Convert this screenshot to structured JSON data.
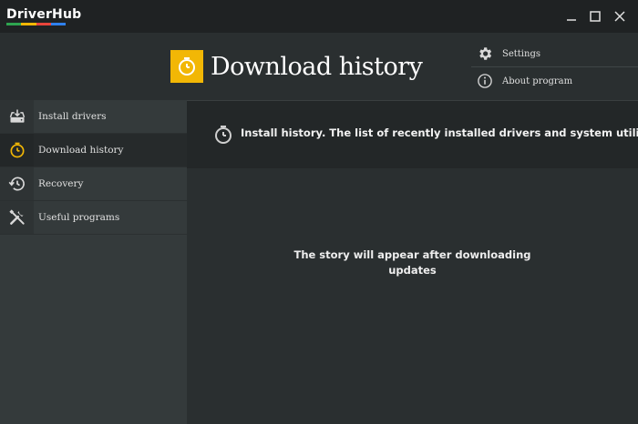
{
  "app": {
    "name": "DriverHub",
    "logo_colors": [
      "#2ea44f",
      "#f2b705",
      "#e8453c",
      "#2f80ed"
    ]
  },
  "window_controls": {
    "minimize_icon": "minimize-icon",
    "maximize_icon": "maximize-icon",
    "close_icon": "close-icon"
  },
  "page": {
    "title": "Download history",
    "title_icon": "stopwatch-icon",
    "accent": "#f2b705"
  },
  "top_menu": {
    "items": [
      {
        "label": "Settings",
        "icon": "gear-icon"
      },
      {
        "label": "About program",
        "icon": "info-icon"
      }
    ]
  },
  "sidebar": {
    "items": [
      {
        "label": "Install drivers",
        "icon": "drive-download-icon",
        "active": false
      },
      {
        "label": "Download history",
        "icon": "stopwatch-icon",
        "active": true
      },
      {
        "label": "Recovery",
        "icon": "history-icon",
        "active": false
      },
      {
        "label": "Useful programs",
        "icon": "tools-icon",
        "active": false
      }
    ]
  },
  "info": {
    "text": "Install history. The list of recently installed drivers and system utilities.",
    "icon": "stopwatch-icon"
  },
  "empty_state": {
    "line1": "The story will appear after downloading",
    "line2": "updates"
  }
}
